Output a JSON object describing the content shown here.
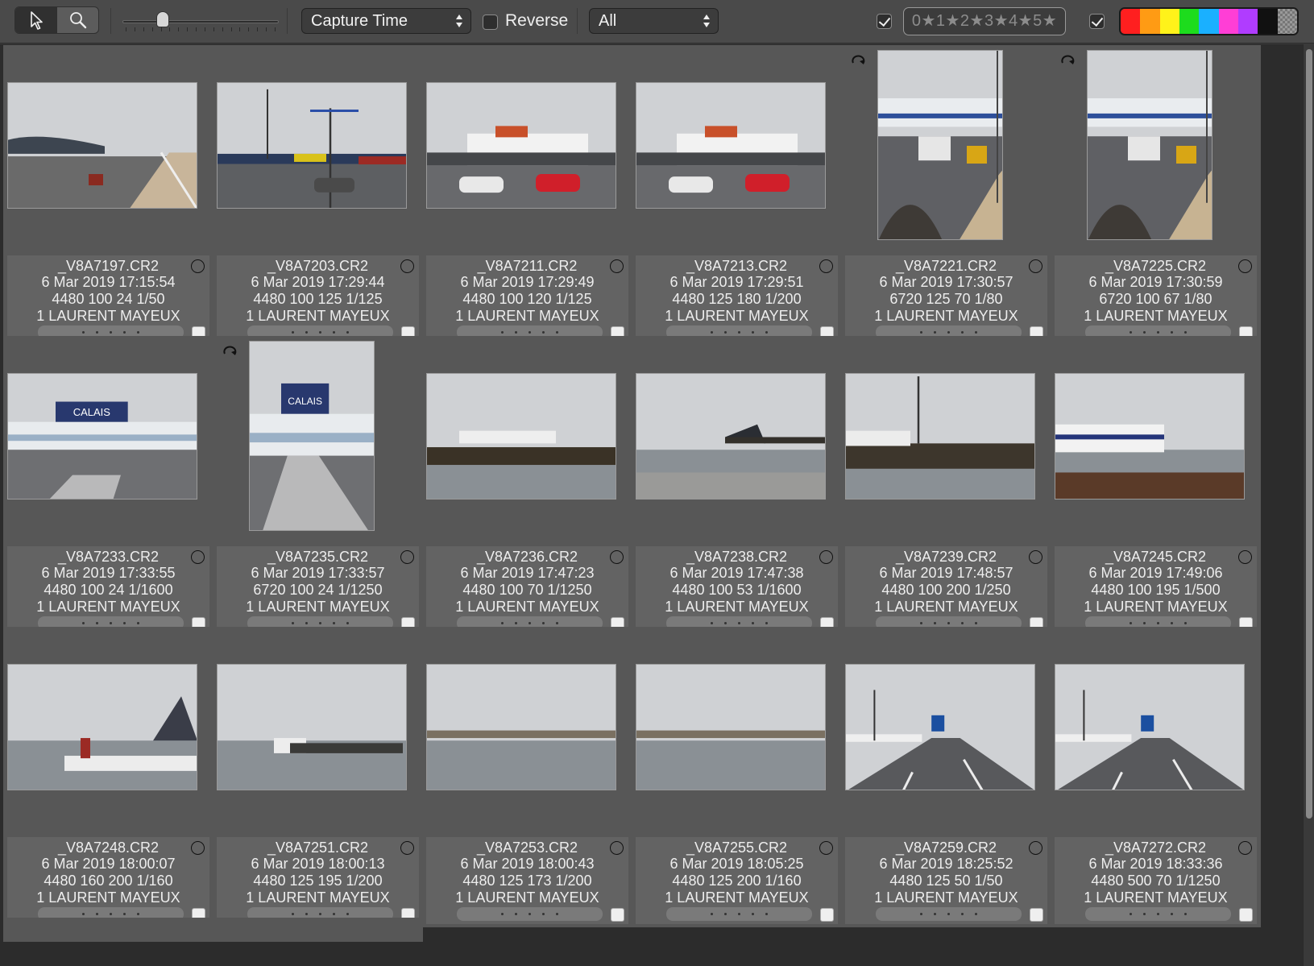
{
  "toolbar": {
    "select_tool": "pointer",
    "zoom_tool": "magnifier",
    "thumbnail_size_level": 0.26,
    "sort_by": "Capture Time",
    "reverse_label": "Reverse",
    "reverse_checked": false,
    "filter": "All",
    "rating_filter_enabled": true,
    "rating_filter_label": "0★1★2★3★4★5★",
    "color_filter_enabled": true,
    "color_labels": [
      "red",
      "orange",
      "yellow",
      "green",
      "blue",
      "magenta",
      "purple",
      "black",
      "none"
    ],
    "color_values": [
      "#ff1f1f",
      "#ff9b14",
      "#fff21a",
      "#1ddc1d",
      "#1ab0ff",
      "#ff3ed6",
      "#b03cff",
      "#111111",
      ""
    ]
  },
  "photos": [
    {
      "filename": "_V8A7197.CR2",
      "date": "6 Mar 2019 17:15:54",
      "exif": "4480 100 24 1/50",
      "owner": "1 LAURENT MAYEUX",
      "orientation": "landscape",
      "rotated": false,
      "scene": "terminal-road"
    },
    {
      "filename": "_V8A7203.CR2",
      "date": "6 Mar 2019 17:29:44",
      "exif": "4480 100 125 1/125",
      "owner": "1 LAURENT MAYEUX",
      "orientation": "landscape",
      "rotated": false,
      "scene": "parking-lights"
    },
    {
      "filename": "_V8A7211.CR2",
      "date": "6 Mar 2019 17:29:49",
      "exif": "4480 100 120 1/125",
      "owner": "1 LAURENT MAYEUX",
      "orientation": "landscape",
      "rotated": false,
      "scene": "ferry-parking"
    },
    {
      "filename": "_V8A7213.CR2",
      "date": "6 Mar 2019 17:29:51",
      "exif": "4480 125 180 1/200",
      "owner": "1 LAURENT MAYEUX",
      "orientation": "landscape",
      "rotated": false,
      "scene": "ferry-parking"
    },
    {
      "filename": "_V8A7221.CR2",
      "date": "6 Mar 2019 17:30:57",
      "exif": "6720 125 70 1/80",
      "owner": "1 LAURENT MAYEUX",
      "orientation": "portrait",
      "rotated": true,
      "scene": "road-works"
    },
    {
      "filename": "_V8A7225.CR2",
      "date": "6 Mar 2019 17:30:59",
      "exif": "6720 100 67 1/80",
      "owner": "1 LAURENT MAYEUX",
      "orientation": "portrait",
      "rotated": true,
      "scene": "road-works"
    },
    {
      "filename": "_V8A7233.CR2",
      "date": "6 Mar 2019 17:33:55",
      "exif": "4480 100 24 1/1600",
      "owner": "1 LAURENT MAYEUX",
      "orientation": "landscape",
      "rotated": false,
      "scene": "terminal-building",
      "sign": "CALAIS"
    },
    {
      "filename": "_V8A7235.CR2",
      "date": "6 Mar 2019 17:33:57",
      "exif": "6720 100 24 1/1250",
      "owner": "1 LAURENT MAYEUX",
      "orientation": "portrait",
      "rotated": true,
      "scene": "terminal-crossing",
      "sign": "CALAIS"
    },
    {
      "filename": "_V8A7236.CR2",
      "date": "6 Mar 2019 17:47:23",
      "exif": "4480 100 70 1/1250",
      "owner": "1 LAURENT MAYEUX",
      "orientation": "landscape",
      "rotated": false,
      "scene": "harbour-pier"
    },
    {
      "filename": "_V8A7238.CR2",
      "date": "6 Mar 2019 17:47:38",
      "exif": "4480 100 53 1/1600",
      "owner": "1 LAURENT MAYEUX",
      "orientation": "landscape",
      "rotated": false,
      "scene": "harbour-entrance"
    },
    {
      "filename": "_V8A7239.CR2",
      "date": "6 Mar 2019 17:48:57",
      "exif": "4480 100 200 1/250",
      "owner": "1 LAURENT MAYEUX",
      "orientation": "landscape",
      "rotated": false,
      "scene": "harbour-berth"
    },
    {
      "filename": "_V8A7245.CR2",
      "date": "6 Mar 2019 17:49:06",
      "exif": "4480 100 195 1/500",
      "owner": "1 LAURENT MAYEUX",
      "orientation": "landscape",
      "rotated": false,
      "scene": "ferry-berth"
    },
    {
      "filename": "_V8A7248.CR2",
      "date": "6 Mar 2019 18:00:07",
      "exif": "4480 160 200 1/160",
      "owner": "1 LAURENT MAYEUX",
      "orientation": "landscape",
      "rotated": false,
      "scene": "port-office"
    },
    {
      "filename": "_V8A7251.CR2",
      "date": "6 Mar 2019 18:00:13",
      "exif": "4480 125 195 1/200",
      "owner": "1 LAURENT MAYEUX",
      "orientation": "landscape",
      "rotated": false,
      "scene": "ferry-distant"
    },
    {
      "filename": "_V8A7253.CR2",
      "date": "6 Mar 2019 18:00:43",
      "exif": "4480 125 173 1/200",
      "owner": "1 LAURENT MAYEUX",
      "orientation": "landscape",
      "rotated": false,
      "scene": "sea-shore"
    },
    {
      "filename": "_V8A7255.CR2",
      "date": "6 Mar 2019 18:05:25",
      "exif": "4480 125 200 1/160",
      "owner": "1 LAURENT MAYEUX",
      "orientation": "landscape",
      "rotated": false,
      "scene": "sea-shore"
    },
    {
      "filename": "_V8A7259.CR2",
      "date": "6 Mar 2019 18:25:52",
      "exif": "4480 125 50 1/50",
      "owner": "1 LAURENT MAYEUX",
      "orientation": "landscape",
      "rotated": false,
      "scene": "motorway"
    },
    {
      "filename": "_V8A7272.CR2",
      "date": "6 Mar 2019 18:33:36",
      "exif": "4480 500 70 1/1250",
      "owner": "1 LAURENT MAYEUX",
      "orientation": "landscape",
      "rotated": false,
      "scene": "motorway"
    }
  ]
}
